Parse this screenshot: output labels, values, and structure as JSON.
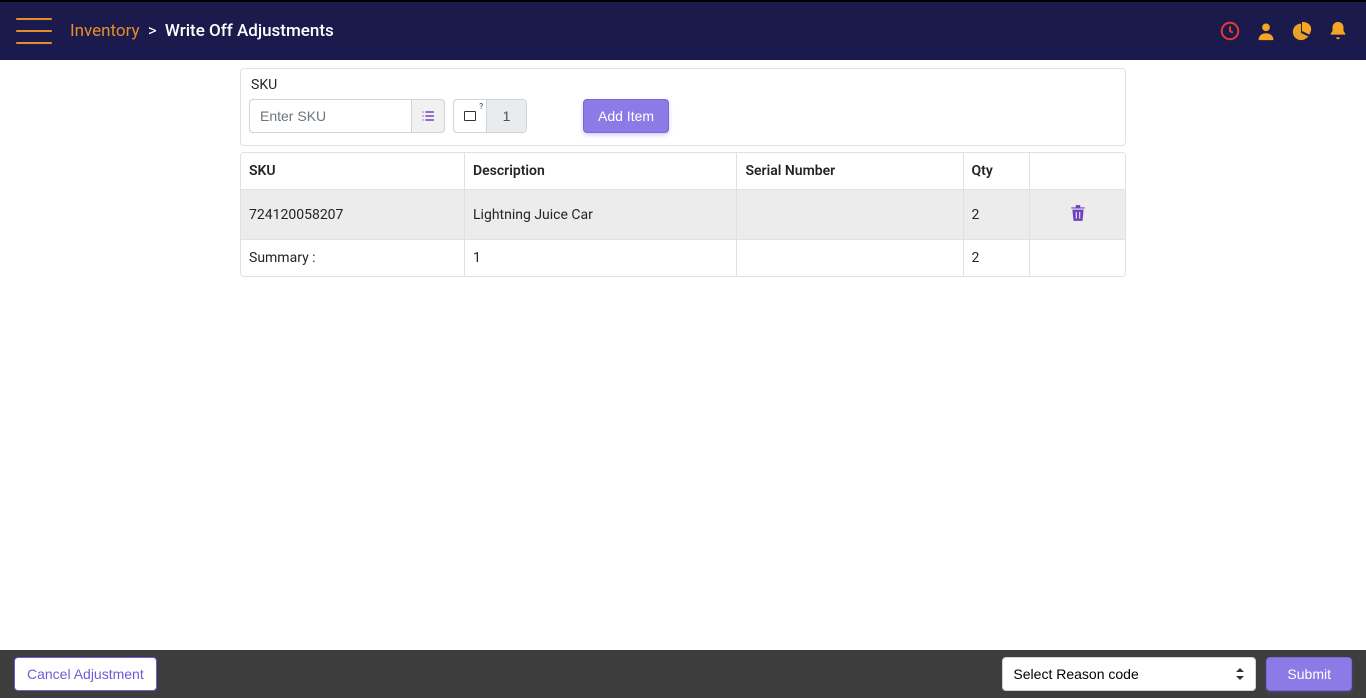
{
  "header": {
    "breadcrumb_link": "Inventory",
    "breadcrumb_sep": ">",
    "breadcrumb_current": "Write Off Adjustments"
  },
  "sku_section": {
    "label": "SKU",
    "placeholder": "Enter SKU",
    "qty_value": "1",
    "add_button": "Add Item"
  },
  "table": {
    "headers": {
      "sku": "SKU",
      "description": "Description",
      "serial": "Serial Number",
      "qty": "Qty"
    },
    "rows": [
      {
        "sku": "724120058207",
        "description": "Lightning Juice Car",
        "serial": "",
        "qty": "2"
      }
    ],
    "summary": {
      "label": "Summary :",
      "count": "1",
      "serial": "",
      "qty": "2"
    }
  },
  "footer": {
    "cancel": "Cancel Adjustment",
    "reason_placeholder": "Select Reason code",
    "submit": "Submit"
  }
}
